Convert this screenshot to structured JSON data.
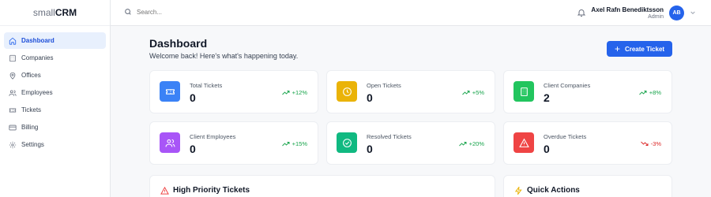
{
  "brand": {
    "prefix": "small",
    "suffix": "CRM"
  },
  "sidebar": {
    "items": [
      {
        "label": "Dashboard",
        "icon": "home-icon",
        "active": true
      },
      {
        "label": "Companies",
        "icon": "building-icon"
      },
      {
        "label": "Offices",
        "icon": "map-pin-icon"
      },
      {
        "label": "Employees",
        "icon": "users-icon"
      },
      {
        "label": "Tickets",
        "icon": "ticket-icon"
      },
      {
        "label": "Billing",
        "icon": "credit-card-icon"
      },
      {
        "label": "Settings",
        "icon": "gear-icon"
      }
    ]
  },
  "topbar": {
    "search_placeholder": "Search...",
    "user_name": "Axel Rafn Benediktsson",
    "user_role": "Admin",
    "avatar_initials": "AB"
  },
  "page": {
    "title": "Dashboard",
    "subtitle": "Welcome back! Here's what's happening today.",
    "create_button": "Create Ticket"
  },
  "stats": [
    {
      "label": "Total Tickets",
      "value": "0",
      "trend": "+12%",
      "direction": "up",
      "color": "#3b82f6",
      "icon": "ticket-icon"
    },
    {
      "label": "Open Tickets",
      "value": "0",
      "trend": "+5%",
      "direction": "up",
      "color": "#eab308",
      "icon": "clock-icon"
    },
    {
      "label": "Client Companies",
      "value": "2",
      "trend": "+8%",
      "direction": "up",
      "color": "#22c55e",
      "icon": "building-icon"
    },
    {
      "label": "Client Employees",
      "value": "0",
      "trend": "+15%",
      "direction": "up",
      "color": "#a855f7",
      "icon": "users-icon"
    },
    {
      "label": "Resolved Tickets",
      "value": "0",
      "trend": "+20%",
      "direction": "up",
      "color": "#10b981",
      "icon": "check-circle-icon"
    },
    {
      "label": "Overdue Tickets",
      "value": "0",
      "trend": "-3%",
      "direction": "down",
      "color": "#ef4444",
      "icon": "alert-triangle-icon"
    }
  ],
  "panels": {
    "high_priority": "High Priority Tickets",
    "quick_actions": "Quick Actions"
  }
}
